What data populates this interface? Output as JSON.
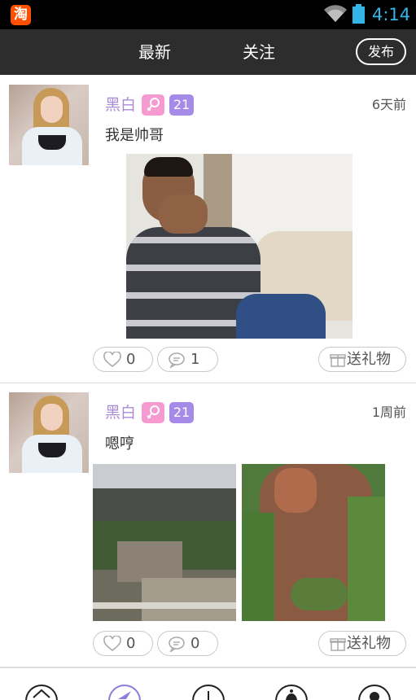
{
  "status_bar": {
    "app_icon_glyph": "淘",
    "time": "4:14",
    "icons": [
      "wifi-icon",
      "battery-icon"
    ]
  },
  "header": {
    "tabs": [
      {
        "label": "最新",
        "active": true
      },
      {
        "label": "关注",
        "active": false
      }
    ],
    "publish_label": "发布"
  },
  "posts": [
    {
      "username": "黑白",
      "age": "21",
      "gender_icon": "female-icon",
      "time": "6天前",
      "text": "我是帅哥",
      "likes": "0",
      "comments": "1",
      "gift_label": "送礼物"
    },
    {
      "username": "黑白",
      "age": "21",
      "gender_icon": "female-icon",
      "time": "1周前",
      "text": "嗯哼",
      "likes": "0",
      "comments": "0",
      "gift_label": "送礼物"
    }
  ],
  "bottom_nav": {
    "items": [
      "home-icon",
      "discover-icon",
      "message-icon",
      "notification-icon",
      "profile-icon"
    ],
    "active": "discover-icon"
  },
  "colors": {
    "header_bg": "#2d2d2d",
    "username": "#a98bd6",
    "gender_badge": "#f59bd2",
    "age_badge": "#a58ae8",
    "status_accent": "#33b5e5"
  }
}
